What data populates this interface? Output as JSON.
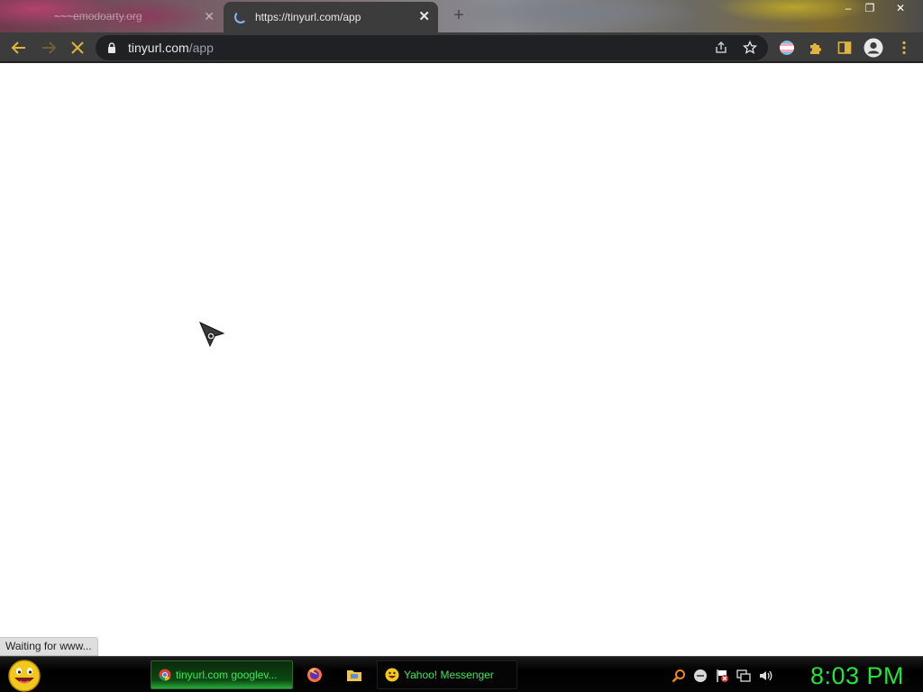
{
  "browser": {
    "tabs": [
      {
        "title": "~~~emodoarty.org",
        "state": "inactive"
      },
      {
        "title": "https://tinyurl.com/app",
        "state": "loading"
      }
    ],
    "new_tab_label": "+",
    "window_controls": {
      "minimize": "–",
      "restore": "❐",
      "close": "✕"
    },
    "address": {
      "host": "tinyurl.com",
      "path": "/app"
    },
    "status_text": "Waiting for www..."
  },
  "taskbar": {
    "task_buttons": [
      {
        "label": "tinyurl.com googlev..."
      },
      {
        "label": "Yahoo! Messenger"
      }
    ],
    "clock": "8:03 PM"
  },
  "colors": {
    "toolbar": "#3c3c3c",
    "omnibox": "#202124",
    "taskbar_text": "#3ee65a",
    "clock": "#22e43a"
  }
}
